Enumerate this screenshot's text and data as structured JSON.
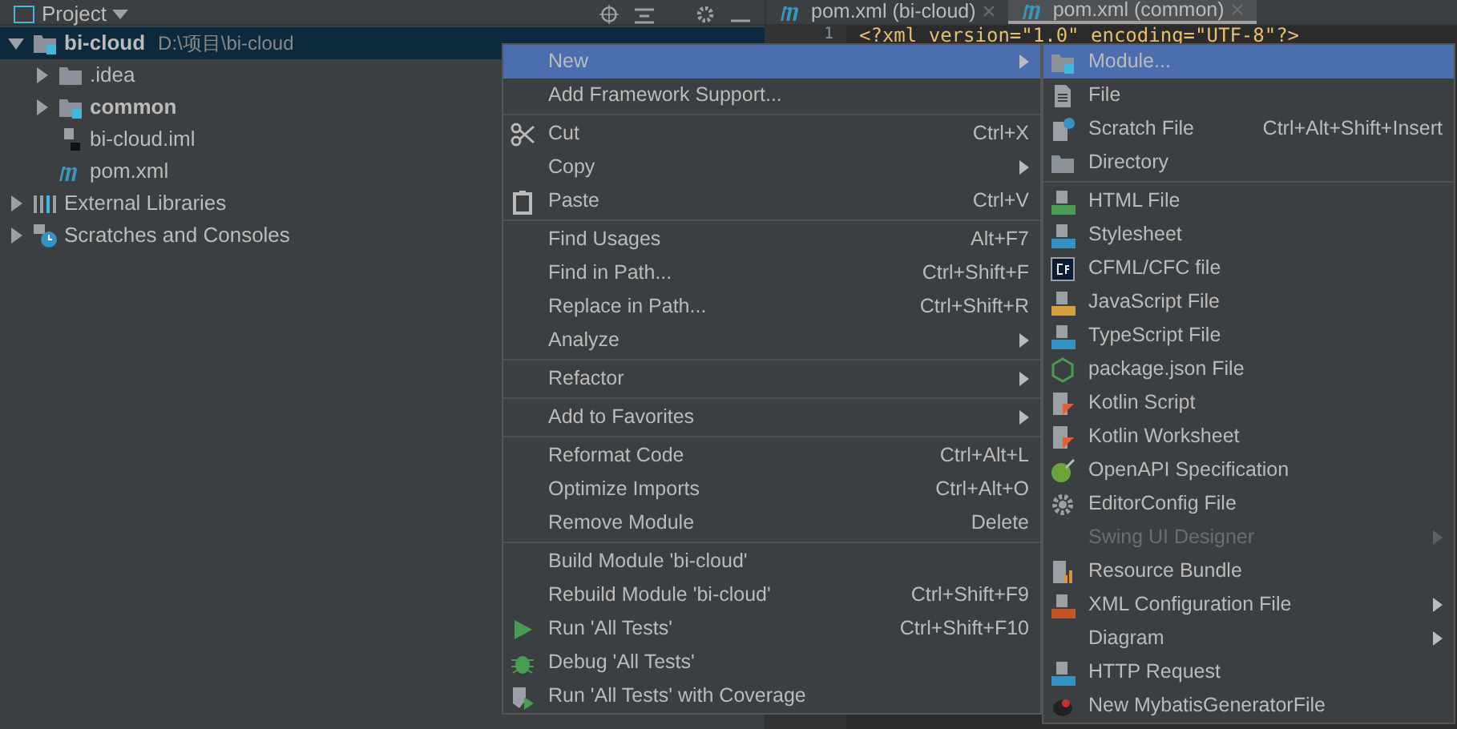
{
  "project_panel": {
    "title": "Project",
    "tree": [
      {
        "name": "bi-cloud",
        "path": "D:\\项目\\bi-cloud",
        "kind": "module",
        "bold": true,
        "expanded": true,
        "selected": true,
        "children": [
          {
            "name": ".idea",
            "kind": "folder",
            "bold": false,
            "expanded": false,
            "selected": false
          },
          {
            "name": "common",
            "kind": "module",
            "bold": true,
            "expanded": false,
            "selected": false
          },
          {
            "name": "bi-cloud.iml",
            "kind": "iml",
            "bold": false,
            "selected": false
          },
          {
            "name": "pom.xml",
            "kind": "maven",
            "bold": false,
            "selected": false
          }
        ]
      },
      {
        "name": "External Libraries",
        "kind": "libraries",
        "bold": false,
        "expanded": false,
        "selected": false
      },
      {
        "name": "Scratches and Consoles",
        "kind": "scratches",
        "bold": false,
        "expanded": false,
        "selected": false
      }
    ]
  },
  "editor": {
    "tabs": [
      {
        "label": "pom.xml (bi-cloud)",
        "selected": false
      },
      {
        "label": "pom.xml (common)",
        "selected": true
      }
    ],
    "lines": [
      {
        "number": "1",
        "code": "<?xml version=\"1.0\" encoding=\"UTF-8\"?>"
      }
    ]
  },
  "context_menu": [
    {
      "kind": "item",
      "label": "New",
      "submenu": true,
      "selected": true
    },
    {
      "kind": "item",
      "label": "Add Framework Support...",
      "selected": false
    },
    {
      "kind": "separator"
    },
    {
      "kind": "scissors",
      "label": "Cut",
      "shortcut": "Ctrl+X",
      "selected": false
    },
    {
      "kind": "item",
      "label": "Copy",
      "submenu": true,
      "selected": false
    },
    {
      "kind": "clipboard",
      "label": "Paste",
      "shortcut": "Ctrl+V",
      "selected": false
    },
    {
      "kind": "separator"
    },
    {
      "kind": "item",
      "label": "Find Usages",
      "shortcut": "Alt+F7",
      "selected": false
    },
    {
      "kind": "item",
      "label": "Find in Path...",
      "shortcut": "Ctrl+Shift+F",
      "selected": false
    },
    {
      "kind": "item",
      "label": "Replace in Path...",
      "shortcut": "Ctrl+Shift+R",
      "selected": false
    },
    {
      "kind": "item",
      "label": "Analyze",
      "submenu": true,
      "selected": false
    },
    {
      "kind": "separator"
    },
    {
      "kind": "item",
      "label": "Refactor",
      "submenu": true,
      "selected": false
    },
    {
      "kind": "separator"
    },
    {
      "kind": "item",
      "label": "Add to Favorites",
      "submenu": true,
      "selected": false
    },
    {
      "kind": "separator"
    },
    {
      "kind": "item",
      "label": "Reformat Code",
      "shortcut": "Ctrl+Alt+L",
      "selected": false
    },
    {
      "kind": "item",
      "label": "Optimize Imports",
      "shortcut": "Ctrl+Alt+O",
      "selected": false
    },
    {
      "kind": "item",
      "label": "Remove Module",
      "shortcut": "Delete",
      "selected": false
    },
    {
      "kind": "separator"
    },
    {
      "kind": "item",
      "label": "Build Module 'bi-cloud'",
      "selected": false
    },
    {
      "kind": "item",
      "label": "Rebuild Module 'bi-cloud'",
      "shortcut": "Ctrl+Shift+F9",
      "selected": false
    },
    {
      "kind": "run",
      "label": "Run 'All Tests'",
      "shortcut": "Ctrl+Shift+F10",
      "selected": false
    },
    {
      "kind": "bug",
      "label": "Debug 'All Tests'",
      "selected": false
    },
    {
      "kind": "coverage",
      "label": "Run 'All Tests' with Coverage",
      "selected": false
    }
  ],
  "new_submenu": [
    {
      "kind": "module",
      "label": "Module...",
      "selected": true,
      "disabled": false
    },
    {
      "kind": "file",
      "label": "File",
      "selected": false,
      "disabled": false
    },
    {
      "kind": "scratch",
      "label": "Scratch File",
      "shortcut": "Ctrl+Alt+Shift+Insert",
      "selected": false,
      "disabled": false
    },
    {
      "kind": "folder",
      "label": "Directory",
      "selected": false,
      "disabled": false
    },
    {
      "kind": "separator"
    },
    {
      "kind": "html",
      "label": "HTML File",
      "selected": false,
      "disabled": false
    },
    {
      "kind": "css",
      "label": "Stylesheet",
      "selected": false,
      "disabled": false
    },
    {
      "kind": "cf",
      "label": "CFML/CFC file",
      "selected": false,
      "disabled": false
    },
    {
      "kind": "js",
      "label": "JavaScript File",
      "selected": false,
      "disabled": false
    },
    {
      "kind": "ts",
      "label": "TypeScript File",
      "selected": false,
      "disabled": false
    },
    {
      "kind": "node",
      "label": "package.json File",
      "selected": false,
      "disabled": false
    },
    {
      "kind": "kotlin",
      "label": "Kotlin Script",
      "selected": false,
      "disabled": false
    },
    {
      "kind": "kotlin",
      "label": "Kotlin Worksheet",
      "selected": false,
      "disabled": false
    },
    {
      "kind": "openapi",
      "label": "OpenAPI Specification",
      "selected": false,
      "disabled": false
    },
    {
      "kind": "gear",
      "label": "EditorConfig File",
      "selected": false,
      "disabled": false
    },
    {
      "kind": "item",
      "label": "Swing UI Designer",
      "submenu": true,
      "selected": false,
      "disabled": true
    },
    {
      "kind": "bundle",
      "label": "Resource Bundle",
      "selected": false,
      "disabled": false
    },
    {
      "kind": "xml",
      "label": "XML Configuration File",
      "submenu": true,
      "selected": false,
      "disabled": false
    },
    {
      "kind": "item",
      "label": "Diagram",
      "submenu": true,
      "selected": false,
      "disabled": false
    },
    {
      "kind": "api",
      "label": "HTTP Request",
      "selected": false,
      "disabled": false
    },
    {
      "kind": "mybatis",
      "label": "New MybatisGeneratorFile",
      "selected": false,
      "disabled": false
    }
  ]
}
